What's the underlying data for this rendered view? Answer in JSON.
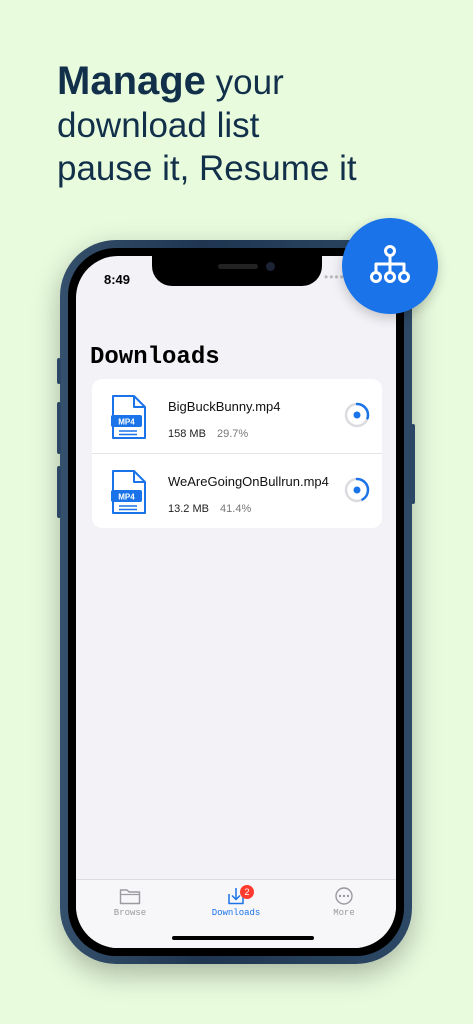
{
  "headline": {
    "strong": "Manage",
    "line1_rest": " your",
    "line2": "download list",
    "line3": "pause it, Resume it"
  },
  "status_bar": {
    "time": "8:49"
  },
  "downloads": {
    "title": "Downloads",
    "items": [
      {
        "file_type": "MP4",
        "name": "BigBuckBunny.mp4",
        "size": "158 MB",
        "progress": "29.7%",
        "progress_fraction": 0.297
      },
      {
        "file_type": "MP4",
        "name": "WeAreGoingOnBullrun.mp4",
        "size": "13.2 MB",
        "progress": "41.4%",
        "progress_fraction": 0.414
      }
    ]
  },
  "tabbar": {
    "tabs": [
      {
        "label": "Browse",
        "icon": "folder-icon"
      },
      {
        "label": "Downloads",
        "icon": "download-icon",
        "badge": "2",
        "active": true
      },
      {
        "label": "More",
        "icon": "more-icon"
      }
    ]
  },
  "colors": {
    "accent": "#1a73e8",
    "background": "#e8fbdd",
    "headline": "#12304a",
    "badge": "#ff3b30"
  },
  "fab": {
    "icon": "network-tree-icon"
  }
}
